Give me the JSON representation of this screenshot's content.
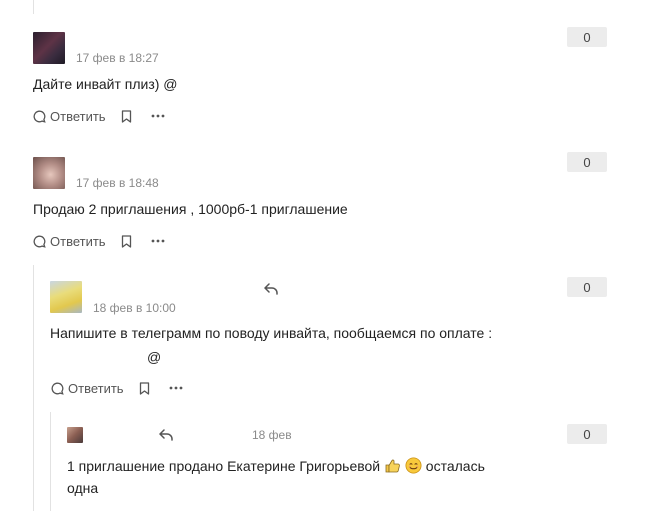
{
  "comments": [
    {
      "time": "17 фев в 18:27",
      "text": "Дайте инвайт плиз) @",
      "reply_label": "Ответить",
      "score": "0",
      "avatar_colors": [
        "#3a2a3a",
        "#6b3b4b"
      ]
    },
    {
      "time": "17 фев в 18:48",
      "text": "Продаю 2 приглашения , 1000рб-1 приглашение",
      "reply_label": "Ответить",
      "score": "0",
      "avatar_colors": [
        "#c9a9a0",
        "#8c6a64"
      ]
    },
    {
      "time": "18 фев в 10:00",
      "text_line1": "Напишите в телеграмм по поводу инвайта, пообщаемся по оплате  :",
      "text_line2": "@",
      "reply_label": "Ответить",
      "score": "0",
      "avatar_colors": [
        "#e8d56a",
        "#b9c9d9"
      ]
    },
    {
      "time": "18 фев",
      "text_line1": "1 приглашение продано Екатерине Григорьевой",
      "text_line1_suffix": "осталась",
      "text_line2": "одна",
      "score": "0",
      "avatar_colors": [
        "#b08070",
        "#5a4a4a"
      ]
    }
  ],
  "icons": {
    "reply": "speech-bubble-icon",
    "bookmark": "bookmark-icon",
    "more": "more-dots-icon",
    "reply_to": "reply-arrow-icon",
    "thumbs_up": "thumbs-up-emoji",
    "smile": "smiling-face-emoji"
  }
}
